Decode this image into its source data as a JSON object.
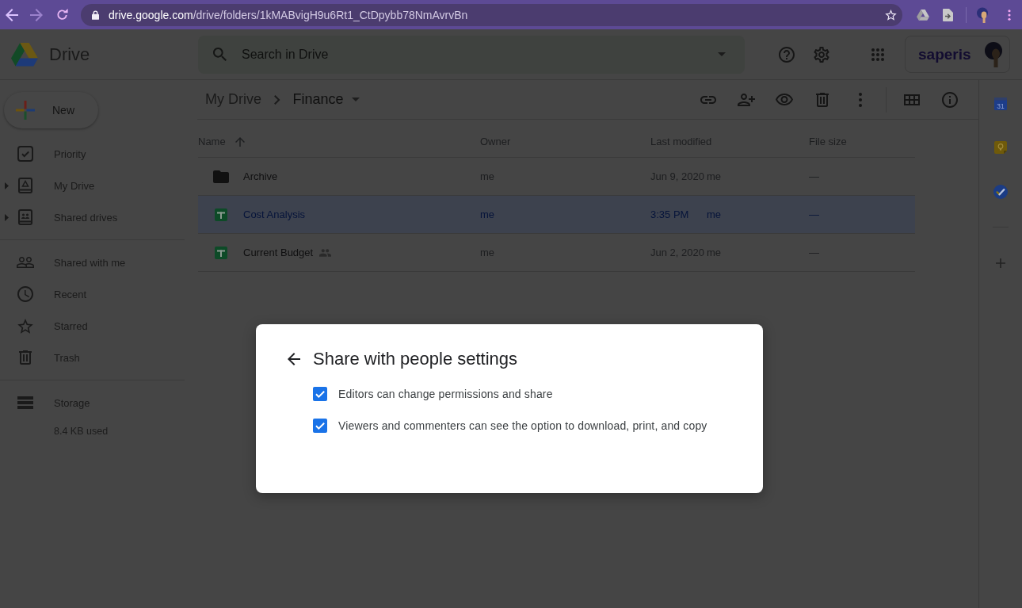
{
  "browser": {
    "url_host": "drive.google.com",
    "url_path": "/drive/folders/1kMABvigH9u6Rt1_CtDpybb78NmAvrvBn"
  },
  "header": {
    "app_name": "Drive",
    "search": {
      "placeholder": "Search in Drive"
    },
    "account": {
      "brand": "saperis"
    }
  },
  "sidebar": {
    "new_button": "New",
    "sections": [
      {
        "items": [
          {
            "label": "Priority",
            "expandable": false,
            "selected": false
          },
          {
            "label": "My Drive",
            "expandable": true,
            "selected": false
          },
          {
            "label": "Shared drives",
            "expandable": true,
            "selected": false
          }
        ]
      },
      {
        "items": [
          {
            "label": "Shared with me",
            "expandable": false,
            "selected": false
          },
          {
            "label": "Recent",
            "expandable": false,
            "selected": false
          },
          {
            "label": "Starred",
            "expandable": false,
            "selected": false
          },
          {
            "label": "Trash",
            "expandable": false,
            "selected": false
          }
        ]
      }
    ],
    "storage": {
      "label": "Storage",
      "usage": "8.4 KB used"
    }
  },
  "breadcrumb": [
    "My Drive",
    "Finance"
  ],
  "table": {
    "columns": [
      {
        "label": "Name",
        "sorted": true
      },
      {
        "label": "Owner",
        "sorted": false
      },
      {
        "label": "Last modified",
        "sorted": false
      },
      {
        "label": "File size",
        "sorted": false
      }
    ],
    "rows": [
      {
        "kind": "folder",
        "name": "Archive",
        "shared": false,
        "owner": "me",
        "modified": "Jun 9, 2020",
        "modified_by": "me",
        "size": "—",
        "selected": false
      },
      {
        "kind": "spreadsheet",
        "name": "Cost Analysis",
        "shared": false,
        "owner": "me",
        "modified": "3:35 PM",
        "modified_by": "me",
        "size": "—",
        "selected": true
      },
      {
        "kind": "spreadsheet",
        "name": "Current Budget",
        "shared": true,
        "owner": "me",
        "modified": "Jun 2, 2020",
        "modified_by": "me",
        "size": "—",
        "selected": false
      }
    ]
  },
  "side_panel": {
    "calendar_day": "31"
  },
  "dialog": {
    "title": "Share with people settings",
    "options": [
      {
        "label": "Editors can change permissions and share",
        "checked": true
      },
      {
        "label": "Viewers and commenters can see the option to download, print, and copy",
        "checked": true
      }
    ]
  }
}
